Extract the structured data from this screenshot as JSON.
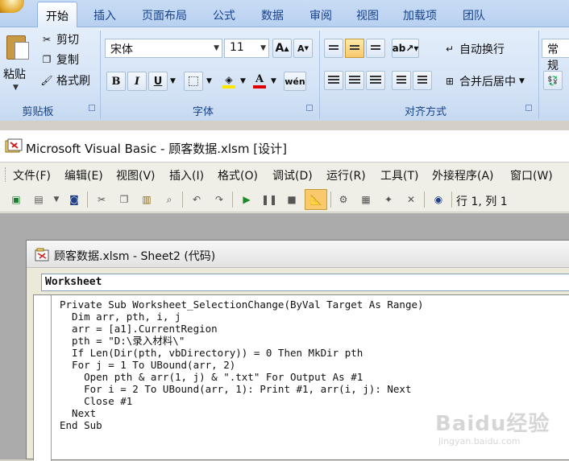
{
  "ribbon": {
    "tabs": [
      "开始",
      "插入",
      "页面布局",
      "公式",
      "数据",
      "审阅",
      "视图",
      "加载项",
      "团队"
    ],
    "active_tab": "开始",
    "clipboard": {
      "paste_label": "粘贴",
      "cut_label": "剪切",
      "copy_label": "复制",
      "format_painter_label": "格式刷",
      "group_label": "剪贴板"
    },
    "font": {
      "font_name": "宋体",
      "font_size": "11",
      "group_label": "字体",
      "font_color": "#e00000",
      "highlight_color": "#ffe600"
    },
    "alignment": {
      "wrap_text_label": "自动换行",
      "merge_center_label": "合并后居中",
      "group_label": "对齐方式"
    },
    "number": {
      "format_value": "常规"
    }
  },
  "vbe": {
    "title": "Microsoft Visual Basic - 顾客数据.xlsm [设计]",
    "menu": [
      "文件(F)",
      "编辑(E)",
      "视图(V)",
      "插入(I)",
      "格式(O)",
      "调试(D)",
      "运行(R)",
      "工具(T)",
      "外接程序(A)",
      "窗口(W)"
    ],
    "cursor_position": "行 1, 列 1",
    "code_window": {
      "title": "顾客数据.xlsm - Sheet2 (代码)",
      "object_combo": "Worksheet",
      "code_lines": [
        "Private Sub Worksheet_SelectionChange(ByVal Target As Range)",
        "  Dim arr, pth, i, j",
        "  arr = [a1].CurrentRegion",
        "  pth = \"D:\\录入材料\\\"",
        "  If Len(Dir(pth, vbDirectory)) = 0 Then MkDir pth",
        "  For j = 1 To UBound(arr, 2)",
        "    Open pth & arr(1, j) & \".txt\" For Output As #1",
        "    For i = 2 To UBound(arr, 1): Print #1, arr(i, j): Next",
        "    Close #1",
        "  Next",
        "End Sub"
      ]
    }
  },
  "watermark": {
    "brand": "Baidu经验",
    "url": "jingyan.baidu.com"
  }
}
